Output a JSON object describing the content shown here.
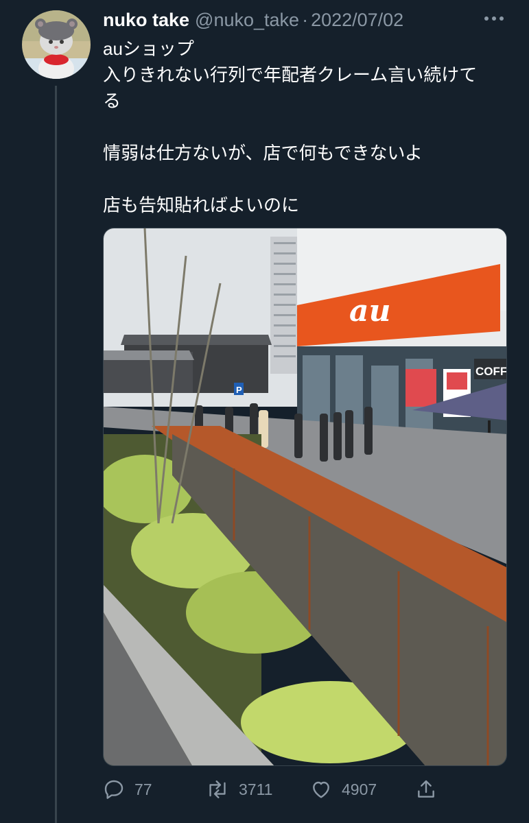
{
  "tweet": {
    "name": "nuko take",
    "handle": "@nuko_take",
    "separator": "·",
    "date": "2022/07/02",
    "text_lines": [
      "auショップ",
      "入りきれない行列で年配者クレーム言い続けて",
      "る",
      "",
      "情弱は仕方ないが、店で何もできないよ",
      "",
      "店も告知貼ればよいのに"
    ],
    "media": {
      "store_sign": "au",
      "cafe_sign": "COFFE",
      "parking_sign": "P"
    }
  },
  "actions": {
    "reply_count": "77",
    "retweet_count": "3711",
    "like_count": "4907"
  },
  "icons": {
    "more": "more-icon",
    "reply": "reply-icon",
    "retweet": "retweet-icon",
    "like": "heart-icon",
    "share": "share-icon"
  },
  "colors": {
    "background": "#15202b",
    "secondary_text": "#8b98a5",
    "store_orange": "#e8561e"
  }
}
